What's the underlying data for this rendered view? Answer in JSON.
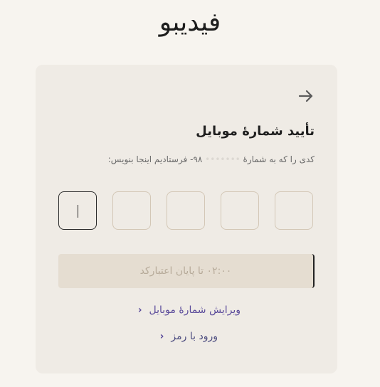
{
  "brand": {
    "logo_text": "فیدیبو"
  },
  "form": {
    "back_icon": "arrow-right-icon",
    "title": "تأیید شمارهٔ موبایل",
    "subtitle_prefix": "کدی را که به شمارهٔ",
    "subtitle_masked": "•••••••",
    "subtitle_suffix": "‎-۹۸ فرستادیم اینجا بنویس:",
    "otp_digits": [
      "",
      "",
      "",
      "",
      ""
    ],
    "submit_label": "۰۲:۰۰ تا پایان اعتبارکد",
    "edit_mobile_label": "ویرایش شمارهٔ موبایل",
    "login_with_password_label": "ورود با رمز",
    "chevron_icon": "chevron-left-icon"
  },
  "colors": {
    "background": "#f7f4ef",
    "card": "#efebe5",
    "otp_border": "#d3c7b6",
    "submit_bg": "#e5ddd1",
    "link": "#5a4a9a"
  }
}
